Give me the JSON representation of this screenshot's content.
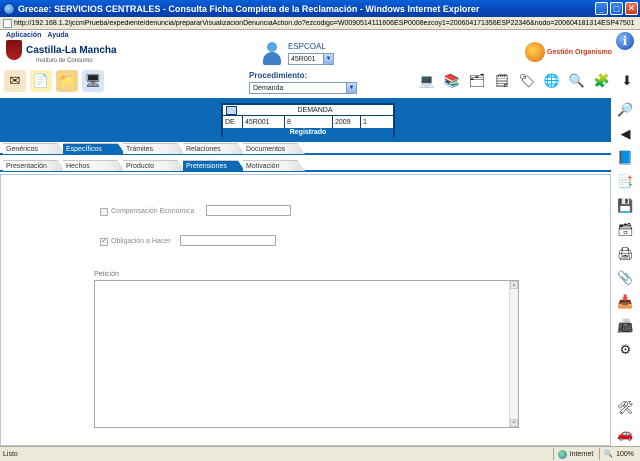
{
  "window": {
    "title": "Grecae: SERVICIOS CENTRALES - Consulta Ficha Completa de la Reclamación - Windows Internet Explorer",
    "url": "http://192.168.1.2/jccmPrueba/expediente/denuncia/prepararVisualizacionDenunciaAction.do?ezcodigo=W0090514111606ESP0008ezcoy1=200604171356ESP22346&nodo=200604181314ESP47501"
  },
  "menu": {
    "items": [
      "Aplicación",
      "Ayuda"
    ]
  },
  "header": {
    "logo_name": "Castilla-La Mancha",
    "logo_sub": "Instituto de Consumo",
    "user_label": "ESPCOAL",
    "user_select": "45R001",
    "gestion_label": "Gestión Organismo",
    "procedimiento_label": "Procedimiento:",
    "procedimiento_value": "Demanda"
  },
  "demanda": {
    "title": "DEMANDA",
    "fields": [
      "DE",
      "45R001",
      "8",
      "2009",
      "1"
    ],
    "status": "Registrado"
  },
  "tabs_row1": [
    {
      "label": "Genéricos",
      "active": false
    },
    {
      "label": "Específicos",
      "active": true
    },
    {
      "label": "Trámites",
      "active": false
    },
    {
      "label": "Relaciones",
      "active": false
    },
    {
      "label": "Documentos",
      "active": false
    }
  ],
  "tabs_row2": [
    {
      "label": "Presentación",
      "active": false
    },
    {
      "label": "Hechos",
      "active": false
    },
    {
      "label": "Producto",
      "active": false
    },
    {
      "label": "Pretensiones",
      "active": true
    },
    {
      "label": "Motivación",
      "active": false
    }
  ],
  "form": {
    "compensacion_label": "Compensación Económica",
    "compensacion_checked": false,
    "compensacion_value": "",
    "obligacion_label": "Obligación a Hacer",
    "obligacion_checked": true,
    "obligacion_value": "",
    "peticion_label": "Petición",
    "peticion_value": ""
  },
  "statusbar": {
    "left": "Listo",
    "zone": "Internet",
    "zoom": "100%"
  },
  "colors": {
    "brand_blue": "#0b69b5",
    "title_bar": "#0846b8",
    "gestion_text": "#c9401e"
  }
}
